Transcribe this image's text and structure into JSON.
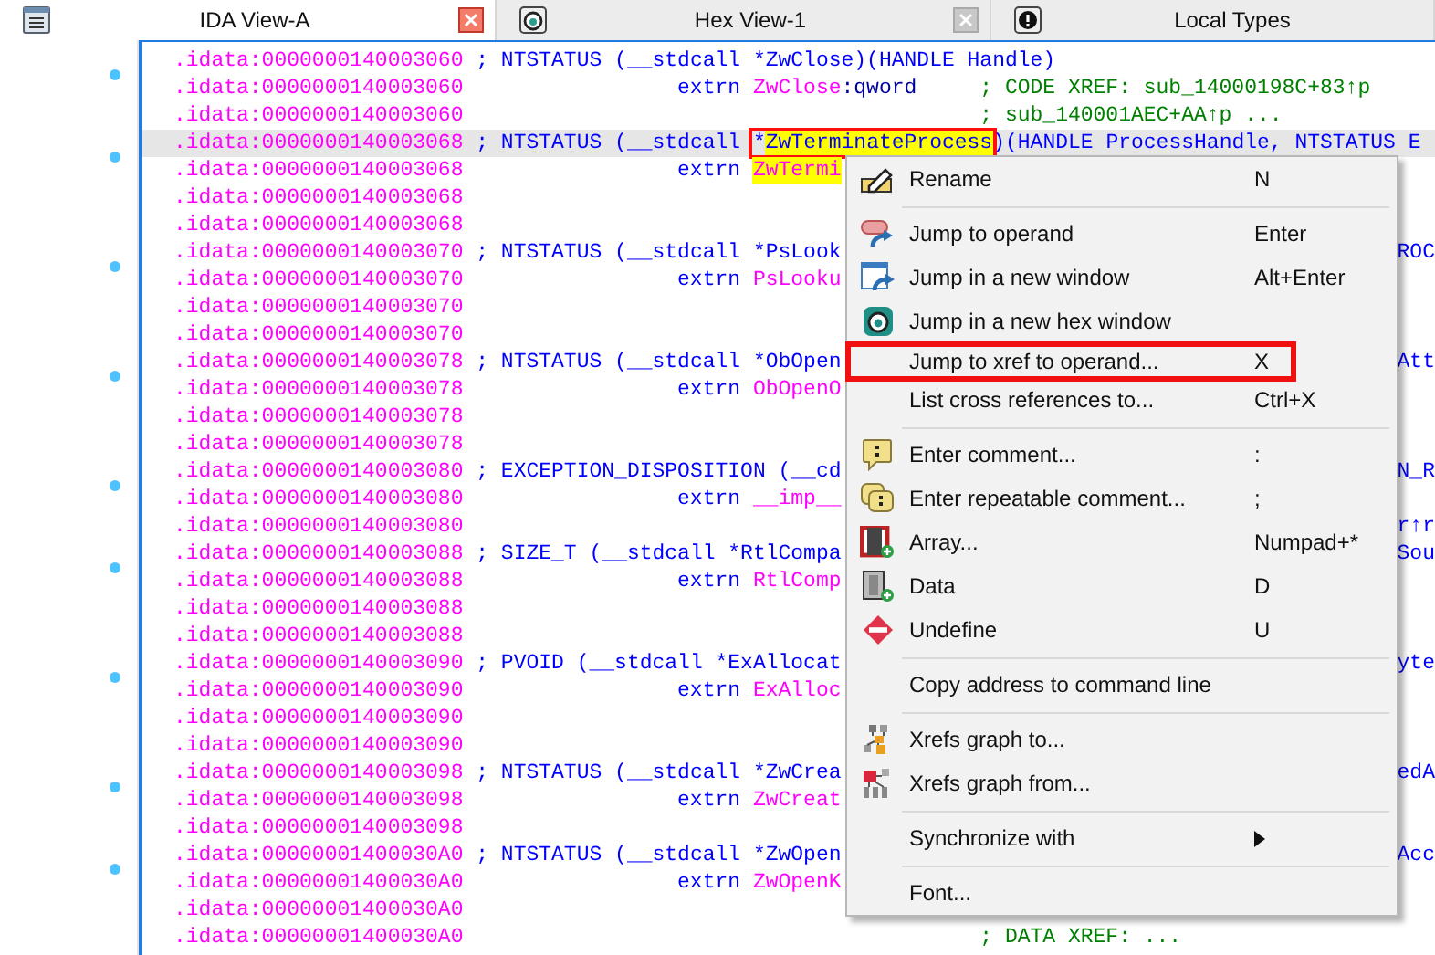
{
  "tabs": [
    {
      "label": "IDA View-A",
      "kind": "listing",
      "selected": true,
      "closable": true
    },
    {
      "label": "Hex View-1",
      "kind": "hex",
      "selected": false,
      "closable": true
    },
    {
      "label": "Local Types",
      "kind": "types",
      "selected": false,
      "closable": false
    }
  ],
  "lines": [
    {
      "address": ".idata:0000000140003060",
      "kind": "header",
      "segments": [
        {
          "text": "; NTSTATUS (__stdcall *ZwClose)(HANDLE Handle)",
          "highlight": false,
          "boxed": false
        }
      ],
      "dot": true,
      "selected": false
    },
    {
      "address": ".idata:0000000140003060",
      "kind": "extrn",
      "keyword": "extrn",
      "name": "ZwClose",
      "suffix": ":qword",
      "highlight": false,
      "comment": "; CODE XREF: sub_14000198C+83↑p",
      "dot": false,
      "selected": false
    },
    {
      "address": ".idata:0000000140003060",
      "kind": "comment",
      "comment": "; sub_140001AEC+AA↑p ...",
      "dot": false,
      "selected": false
    },
    {
      "address": ".idata:0000000140003068",
      "kind": "header",
      "segments": [
        {
          "text": "; NTSTATUS (__stdcall ",
          "highlight": false,
          "boxed": false
        },
        {
          "text": "*",
          "highlight": false,
          "boxed": true
        },
        {
          "text": "ZwTerminateProcess",
          "highlight": true,
          "boxed": true
        },
        {
          "text": ")(HANDLE ProcessHandle, NTSTATUS E",
          "highlight": false,
          "boxed": false
        }
      ],
      "dot": true,
      "selected": true
    },
    {
      "address": ".idata:0000000140003068",
      "kind": "extrn",
      "keyword": "extrn",
      "name": "ZwTermi",
      "highlight": true,
      "dot": false,
      "selected": false
    },
    {
      "address": ".idata:0000000140003068",
      "kind": "blank",
      "dot": false,
      "selected": false
    },
    {
      "address": ".idata:0000000140003068",
      "kind": "blank",
      "dot": false,
      "selected": false
    },
    {
      "address": ".idata:0000000140003070",
      "kind": "header",
      "segments": [
        {
          "text": "; NTSTATUS (__stdcall *PsLook",
          "highlight": false,
          "boxed": false
        }
      ],
      "right": "ROC",
      "dot": true,
      "selected": false
    },
    {
      "address": ".idata:0000000140003070",
      "kind": "extrn",
      "keyword": "extrn",
      "name": "PsLooku",
      "highlight": false,
      "dot": false,
      "selected": false
    },
    {
      "address": ".idata:0000000140003070",
      "kind": "blank",
      "dot": false,
      "selected": false
    },
    {
      "address": ".idata:0000000140003070",
      "kind": "blank",
      "dot": false,
      "selected": false
    },
    {
      "address": ".idata:0000000140003078",
      "kind": "header",
      "segments": [
        {
          "text": "; NTSTATUS (__stdcall *ObOpen",
          "highlight": false,
          "boxed": false
        }
      ],
      "right": "Att",
      "dot": true,
      "selected": false
    },
    {
      "address": ".idata:0000000140003078",
      "kind": "extrn",
      "keyword": "extrn",
      "name": "ObOpenO",
      "highlight": false,
      "dot": false,
      "selected": false
    },
    {
      "address": ".idata:0000000140003078",
      "kind": "blank",
      "dot": false,
      "selected": false
    },
    {
      "address": ".idata:0000000140003078",
      "kind": "blank",
      "dot": false,
      "selected": false
    },
    {
      "address": ".idata:0000000140003080",
      "kind": "header",
      "segments": [
        {
          "text": "; EXCEPTION_DISPOSITION (__cd",
          "highlight": false,
          "boxed": false
        }
      ],
      "right": "N_R",
      "dot": true,
      "selected": false
    },
    {
      "address": ".idata:0000000140003080",
      "kind": "extrn",
      "keyword": "extrn",
      "name": "__imp__",
      "highlight": false,
      "dot": false,
      "selected": false
    },
    {
      "address": ".idata:0000000140003080",
      "kind": "blank",
      "right": "r↑r",
      "dot": false,
      "selected": false
    },
    {
      "address": ".idata:0000000140003088",
      "kind": "header",
      "segments": [
        {
          "text": "; SIZE_T (__stdcall *RtlCompa",
          "highlight": false,
          "boxed": false
        }
      ],
      "right": "Sou",
      "dot": true,
      "selected": false
    },
    {
      "address": ".idata:0000000140003088",
      "kind": "extrn",
      "keyword": "extrn",
      "name": "RtlComp",
      "highlight": false,
      "dot": false,
      "selected": false
    },
    {
      "address": ".idata:0000000140003088",
      "kind": "blank",
      "dot": false,
      "selected": false
    },
    {
      "address": ".idata:0000000140003088",
      "kind": "blank",
      "dot": false,
      "selected": false
    },
    {
      "address": ".idata:0000000140003090",
      "kind": "header",
      "segments": [
        {
          "text": "; PVOID (__stdcall *ExAllocat",
          "highlight": false,
          "boxed": false
        }
      ],
      "right": "yte",
      "dot": true,
      "selected": false
    },
    {
      "address": ".idata:0000000140003090",
      "kind": "extrn",
      "keyword": "extrn",
      "name": "ExAlloc",
      "highlight": false,
      "dot": false,
      "selected": false
    },
    {
      "address": ".idata:0000000140003090",
      "kind": "blank",
      "dot": false,
      "selected": false
    },
    {
      "address": ".idata:0000000140003090",
      "kind": "blank",
      "dot": false,
      "selected": false
    },
    {
      "address": ".idata:0000000140003098",
      "kind": "header",
      "segments": [
        {
          "text": "; NTSTATUS (__stdcall *ZwCrea",
          "highlight": false,
          "boxed": false
        }
      ],
      "right": "edA",
      "dot": true,
      "selected": false
    },
    {
      "address": ".idata:0000000140003098",
      "kind": "extrn",
      "keyword": "extrn",
      "name": "ZwCreat",
      "highlight": false,
      "dot": false,
      "selected": false
    },
    {
      "address": ".idata:0000000140003098",
      "kind": "blank",
      "dot": false,
      "selected": false
    },
    {
      "address": ".idata:00000001400030A0",
      "kind": "header",
      "segments": [
        {
          "text": "; NTSTATUS (__stdcall *ZwOpen",
          "highlight": false,
          "boxed": false
        }
      ],
      "right": "Acc",
      "dot": true,
      "selected": false
    },
    {
      "address": ".idata:00000001400030A0",
      "kind": "extrn",
      "keyword": "extrn",
      "name": "ZwOpenK",
      "highlight": false,
      "dot": false,
      "selected": false
    },
    {
      "address": ".idata:00000001400030A0",
      "kind": "blank",
      "dot": false,
      "selected": false
    },
    {
      "address": ".idata:00000001400030A0",
      "kind": "comment",
      "comment": "; DATA XREF: ...",
      "dot": false,
      "selected": false
    }
  ],
  "menu": {
    "groups": [
      {
        "items": [
          {
            "label": "Rename",
            "shortcut": "N",
            "kind": "rename",
            "boxed": false,
            "submenu": false
          }
        ]
      },
      {
        "items": [
          {
            "label": "Jump to operand",
            "shortcut": "Enter",
            "kind": "jump",
            "boxed": false,
            "submenu": false
          },
          {
            "label": "Jump in a new window",
            "shortcut": "Alt+Enter",
            "kind": "window",
            "boxed": false,
            "submenu": false
          },
          {
            "label": "Jump in a new hex window",
            "kind": "hex",
            "boxed": false,
            "submenu": false
          },
          {
            "label": "Jump to xref to operand...",
            "shortcut": "X",
            "kind": "plain",
            "boxed": true,
            "submenu": false
          },
          {
            "label": "List cross references to...",
            "shortcut": "Ctrl+X",
            "kind": "plain",
            "boxed": false,
            "submenu": false
          }
        ]
      },
      {
        "items": [
          {
            "label": "Enter comment...",
            "shortcut": ":",
            "kind": "comment",
            "boxed": false,
            "submenu": false
          },
          {
            "label": "Enter repeatable comment...",
            "shortcut": ";",
            "kind": "repeat",
            "boxed": false,
            "submenu": false
          },
          {
            "label": "Array...",
            "shortcut": "Numpad+*",
            "kind": "array",
            "boxed": false,
            "submenu": false
          },
          {
            "label": "Data",
            "shortcut": "D",
            "kind": "data",
            "boxed": false,
            "submenu": false
          },
          {
            "label": "Undefine",
            "shortcut": "U",
            "kind": "undefine",
            "boxed": false,
            "submenu": false
          }
        ]
      },
      {
        "items": [
          {
            "label": "Copy address to command line",
            "kind": "plain",
            "boxed": false,
            "submenu": false
          }
        ]
      },
      {
        "items": [
          {
            "label": "Xrefs graph to...",
            "kind": "graph-to",
            "boxed": false,
            "submenu": false
          },
          {
            "label": "Xrefs graph from...",
            "kind": "graph-from",
            "boxed": false,
            "submenu": false
          }
        ]
      },
      {
        "items": [
          {
            "label": "Synchronize with",
            "kind": "plain",
            "boxed": false,
            "submenu": true
          }
        ]
      },
      {
        "items": [
          {
            "label": "Font...",
            "kind": "plain",
            "boxed": false,
            "submenu": false
          }
        ]
      }
    ]
  }
}
